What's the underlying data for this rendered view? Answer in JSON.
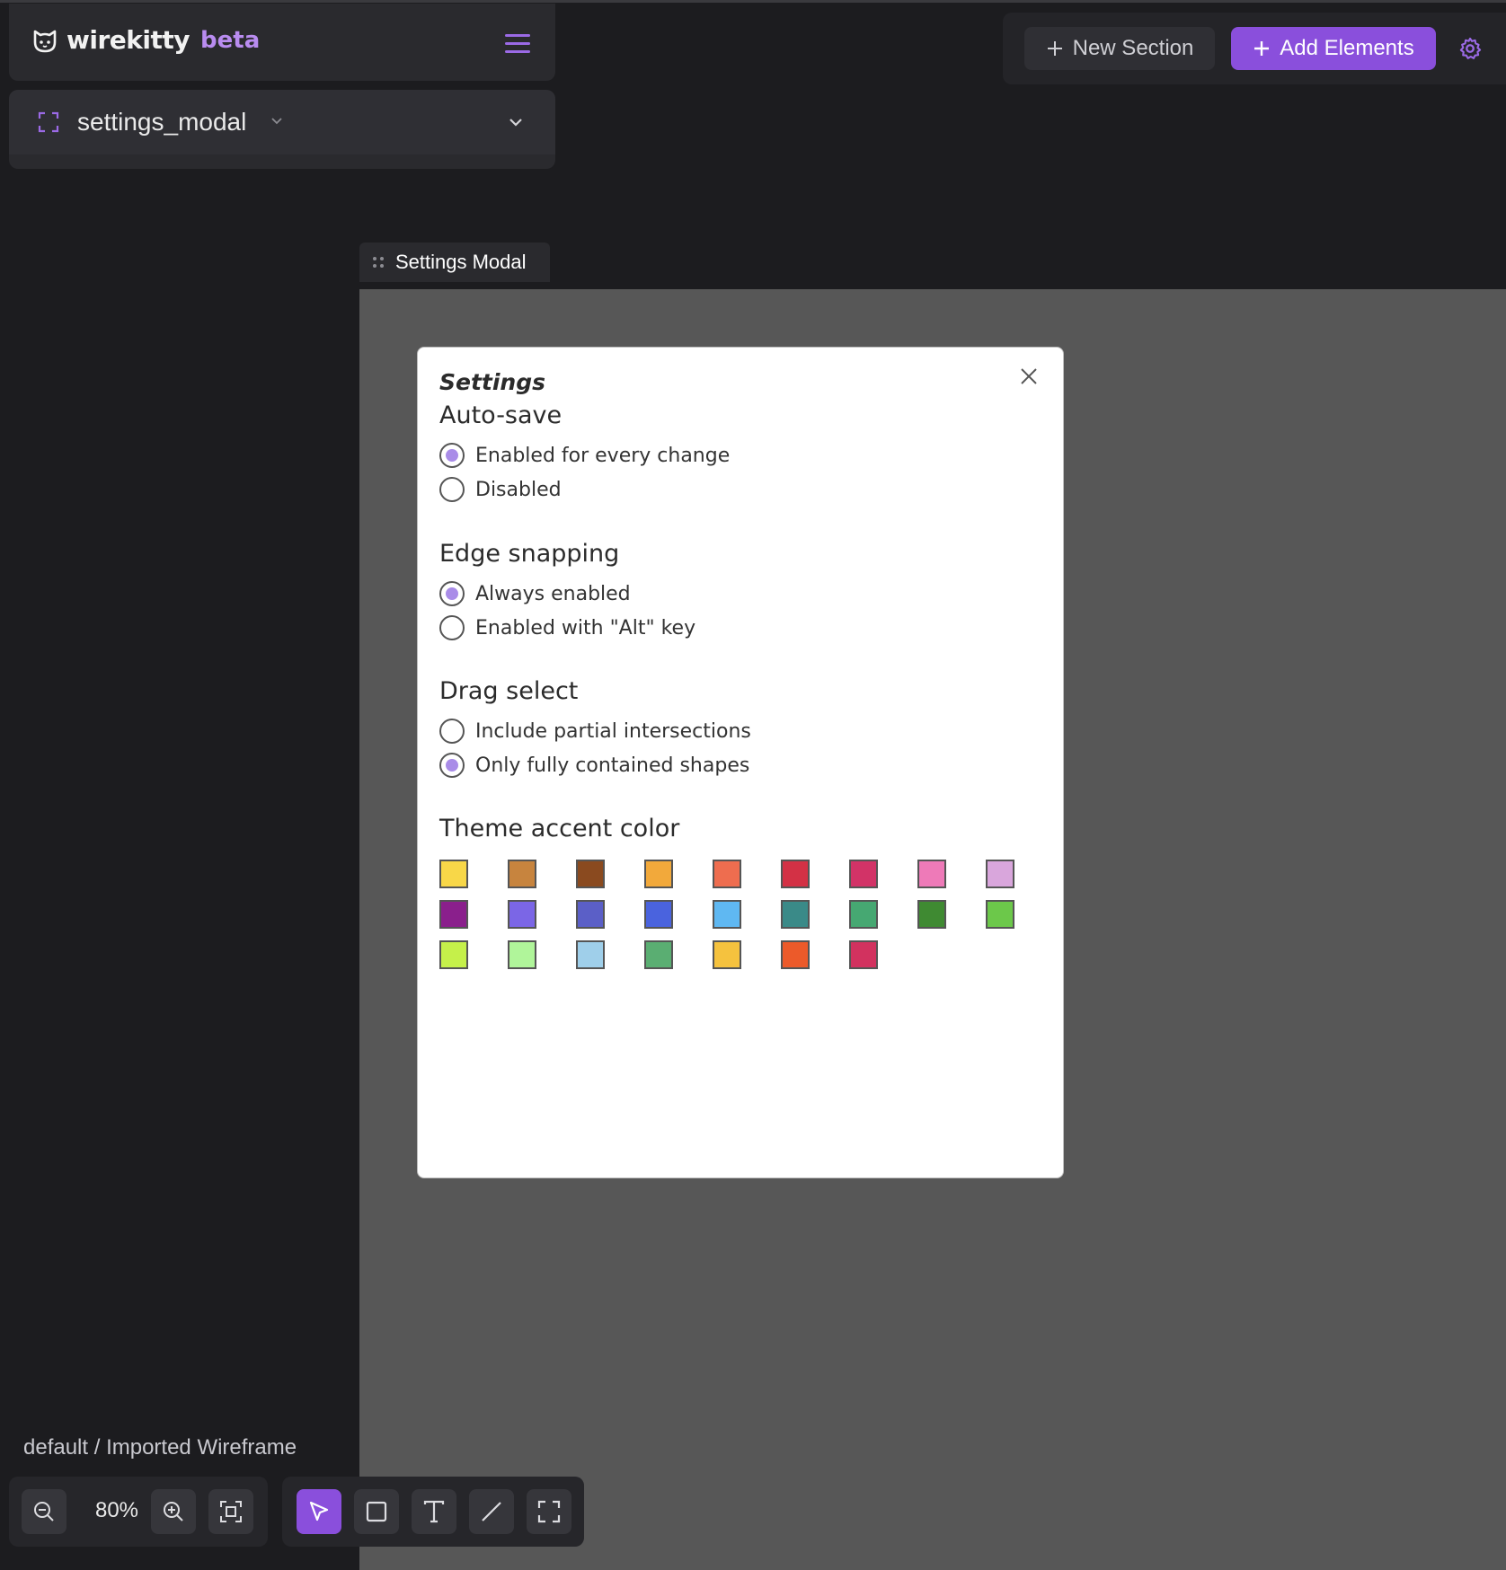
{
  "app": {
    "brand": "wirekitty",
    "badge": "beta"
  },
  "page_selector": {
    "current_page": "settings_modal"
  },
  "top_toolbar": {
    "new_section_label": "New Section",
    "add_elements_label": "Add Elements"
  },
  "frame": {
    "tab_label": "Settings Modal"
  },
  "modal": {
    "title": "Settings",
    "sections": [
      {
        "heading": "Auto-save",
        "options": [
          {
            "label": "Enabled for every change",
            "selected": true
          },
          {
            "label": "Disabled",
            "selected": false
          }
        ]
      },
      {
        "heading": "Edge snapping",
        "options": [
          {
            "label": "Always enabled",
            "selected": true
          },
          {
            "label": "Enabled with \"Alt\" key",
            "selected": false
          }
        ]
      },
      {
        "heading": "Drag select",
        "options": [
          {
            "label": "Include partial intersections",
            "selected": false
          },
          {
            "label": "Only fully contained shapes",
            "selected": true
          }
        ]
      }
    ],
    "accent_heading": "Theme accent color",
    "accent_colors": [
      "#f8d748",
      "#c7843e",
      "#8a4a1f",
      "#f2a93b",
      "#ee6d4f",
      "#d33145",
      "#d23367",
      "#ee7ab8",
      "#d9a6dc",
      "#8a1f8c",
      "#7b66e6",
      "#5b5fc7",
      "#4a63de",
      "#5fb8f2",
      "#3a8a88",
      "#46a872",
      "#3f8a32",
      "#6cc84a",
      "#c5f04a",
      "#b0f59a",
      "#9fcfea",
      "#5aae72",
      "#f5c23e",
      "#ec5a2a",
      "#d2325f"
    ]
  },
  "footer": {
    "breadcrumb": "default / Imported Wireframe",
    "zoom": "80%"
  },
  "colors": {
    "accent": "#8a4fdc",
    "background": "#1c1c1f",
    "canvas": "#575757"
  },
  "icons": [
    "cat-logo-icon",
    "hamburger-menu-icon",
    "frame-icon",
    "chevron-down-icon",
    "plus-icon",
    "gear-icon",
    "drag-handle-icon",
    "close-icon",
    "zoom-out-icon",
    "zoom-in-icon",
    "fit-screen-icon",
    "pointer-icon",
    "rectangle-icon",
    "text-icon",
    "line-icon",
    "frame-tool-icon"
  ]
}
